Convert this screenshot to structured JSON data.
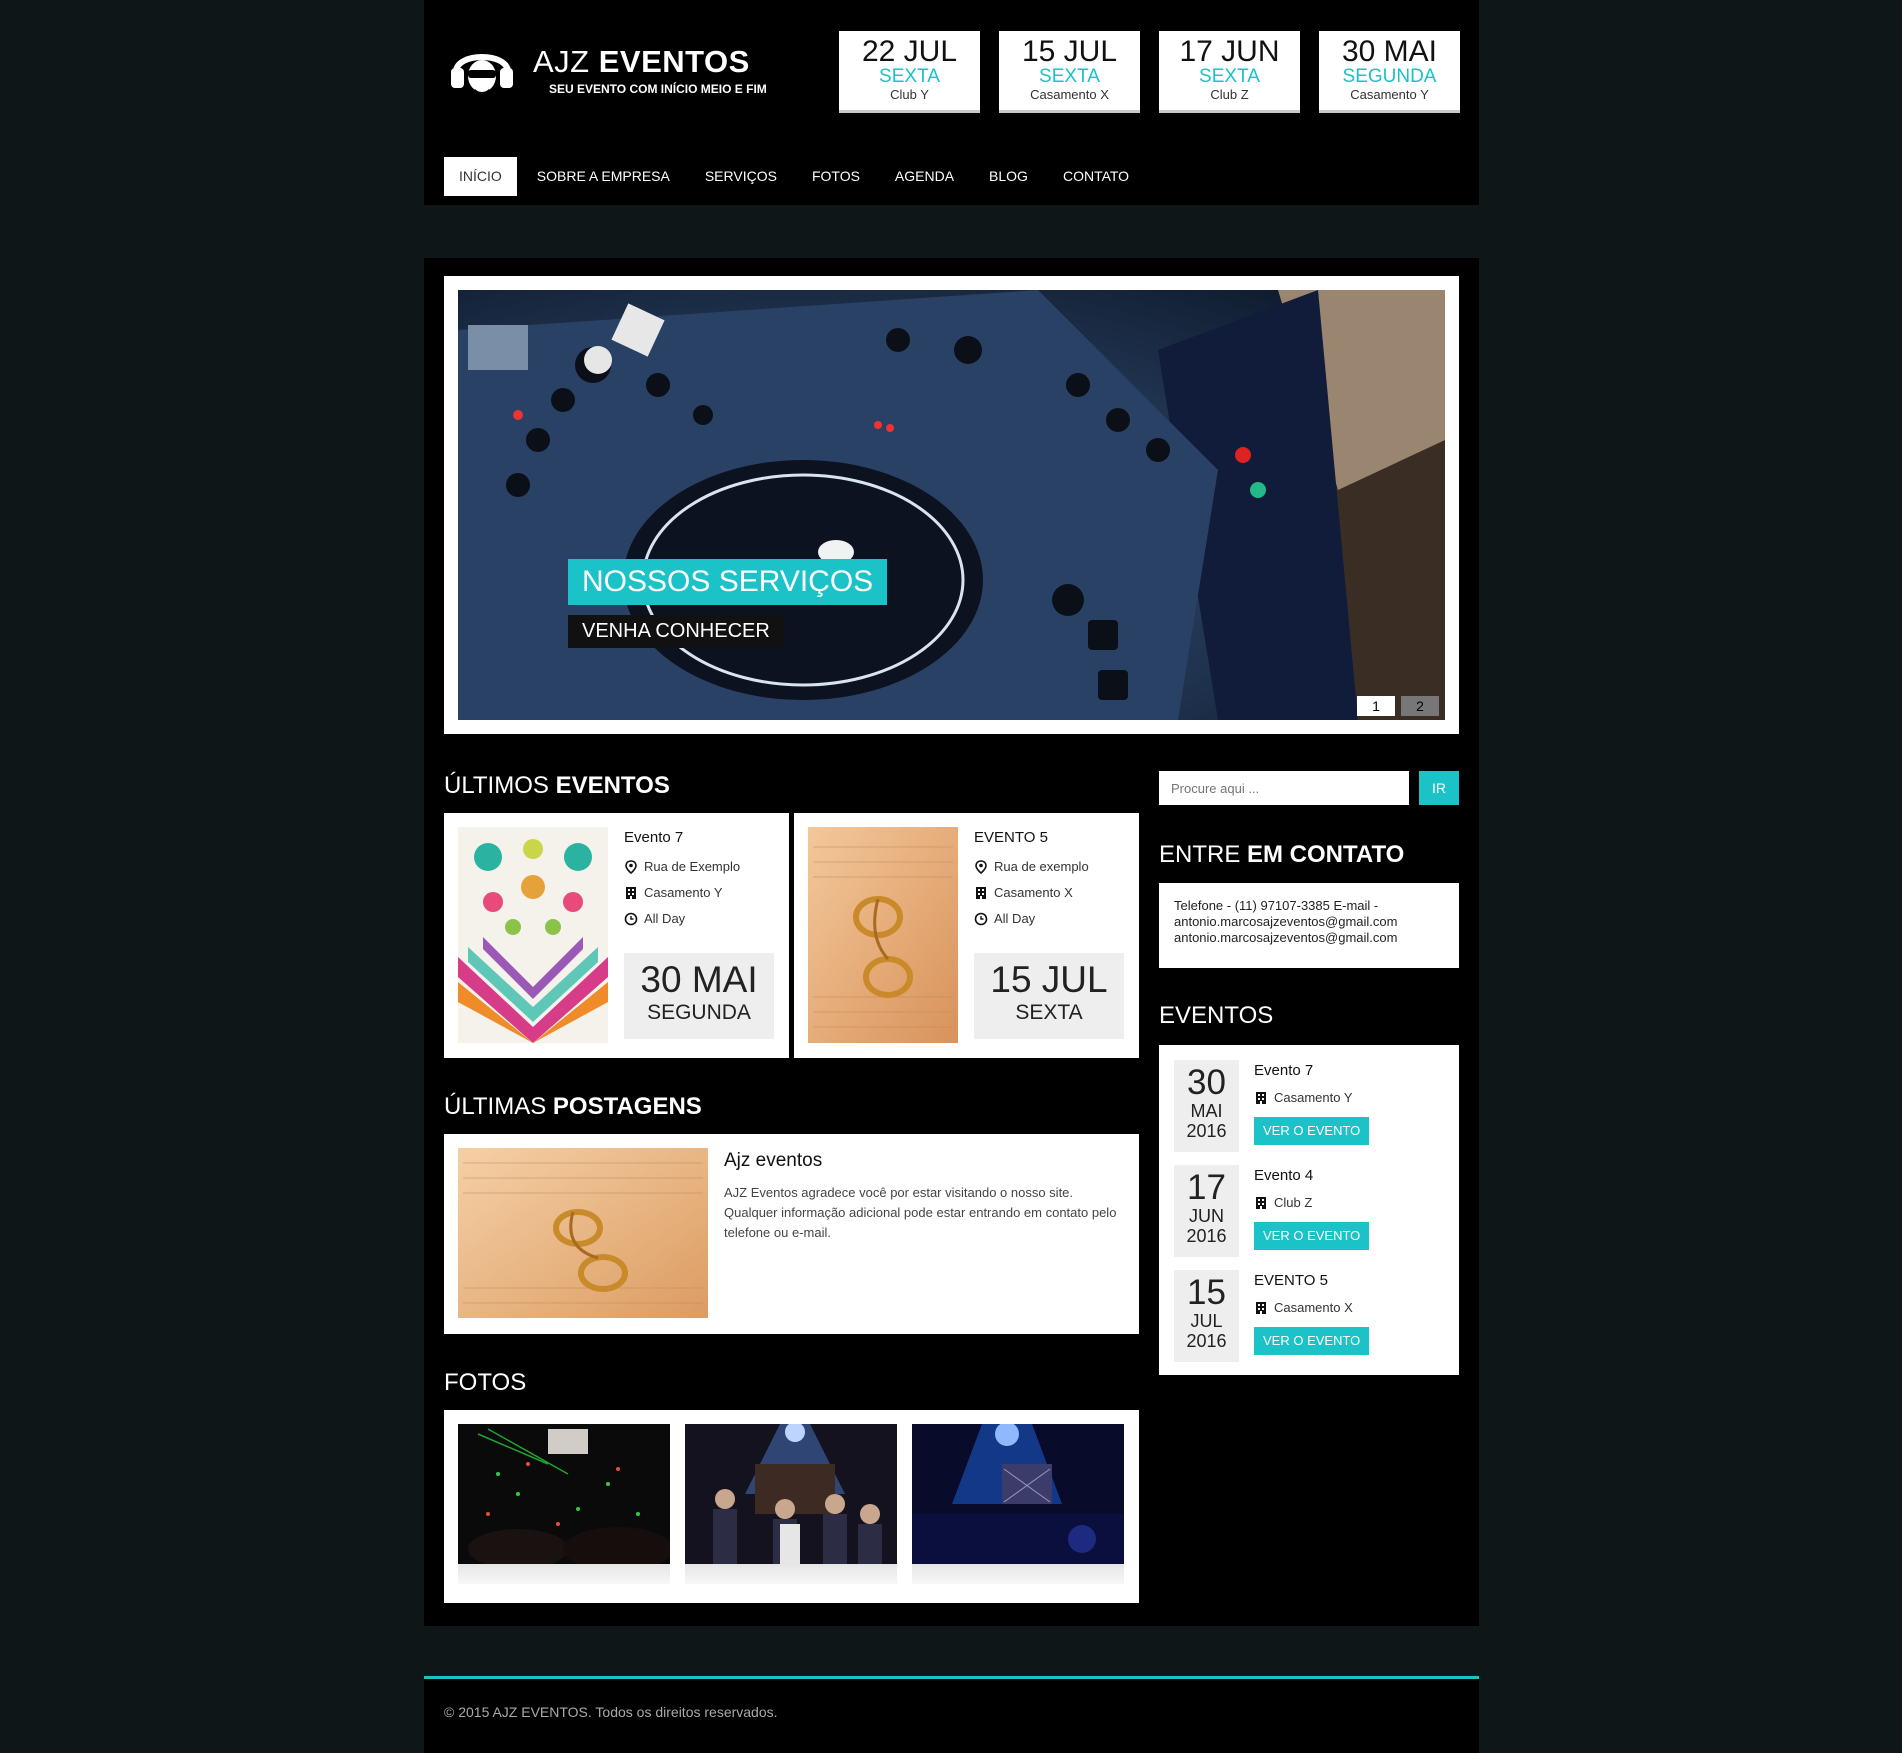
{
  "brand": {
    "name_light": "AJZ",
    "name_bold": "EVENTOS",
    "tagline": "SEU EVENTO COM INÍCIO MEIO E FIM"
  },
  "header_dates": [
    {
      "date": "22 JUL",
      "weekday": "SEXTA",
      "place": "Club Y"
    },
    {
      "date": "15 JUL",
      "weekday": "SEXTA",
      "place": "Casamento X"
    },
    {
      "date": "17 JUN",
      "weekday": "SEXTA",
      "place": "Club Z"
    },
    {
      "date": "30 MAI",
      "weekday": "SEGUNDA",
      "place": "Casamento Y"
    }
  ],
  "nav": [
    {
      "label": "INÍCIO",
      "active": true
    },
    {
      "label": "SOBRE A EMPRESA"
    },
    {
      "label": "SERVIÇOS"
    },
    {
      "label": "FOTOS"
    },
    {
      "label": "AGENDA"
    },
    {
      "label": "BLOG"
    },
    {
      "label": "CONTATO"
    }
  ],
  "slider": {
    "title": "NOSSOS SERVIÇOS",
    "cta": "VENHA CONHECER",
    "pages": [
      "1",
      "2"
    ]
  },
  "latest_events": {
    "title_light": "ÚLTIMOS",
    "title_bold": "EVENTOS",
    "items": [
      {
        "title": "Evento 7",
        "address": "Rua de Exemplo",
        "venue": "Casamento Y",
        "time": "All Day",
        "date": "30 MAI",
        "weekday": "SEGUNDA"
      },
      {
        "title": "EVENTO 5",
        "address": "Rua de exemplo",
        "venue": "Casamento X",
        "time": "All Day",
        "date": "15 JUL",
        "weekday": "SEXTA"
      }
    ]
  },
  "latest_posts": {
    "title_light": "ÚLTIMAS",
    "title_bold": "POSTAGENS",
    "items": [
      {
        "title": "Ajz eventos",
        "text": "AJZ Eventos agradece você por estar visitando o nosso site. Qualquer informação adicional pode estar entrando em contato pelo telefone ou e-mail."
      }
    ]
  },
  "photos": {
    "title": "FOTOS"
  },
  "search": {
    "placeholder": "Procure aqui ...",
    "button": "IR"
  },
  "contact": {
    "title_light": "ENTRE",
    "title_bold": "EM CONTATO",
    "line1": "Telefone - (11) 97107-3385 E-mail -",
    "line2": "antonio.marcosajzeventos@gmail.com",
    "line3": "antonio.marcosajzeventos@gmail.com"
  },
  "events_widget": {
    "title": "EVENTOS",
    "button_label": "VER O EVENTO",
    "items": [
      {
        "day": "30",
        "month": "MAI",
        "year": "2016",
        "name": "Evento 7",
        "venue": "Casamento Y"
      },
      {
        "day": "17",
        "month": "JUN",
        "year": "2016",
        "name": "Evento 4",
        "venue": "Club Z"
      },
      {
        "day": "15",
        "month": "JUL",
        "year": "2016",
        "name": "EVENTO 5",
        "venue": "Casamento X"
      }
    ]
  },
  "footer": {
    "text": "© 2015 AJZ EVENTOS. Todos os direitos reservados."
  },
  "colors": {
    "accent": "#1bc3c8",
    "page_bg": "#0f1618",
    "panel_bg": "#000000"
  }
}
